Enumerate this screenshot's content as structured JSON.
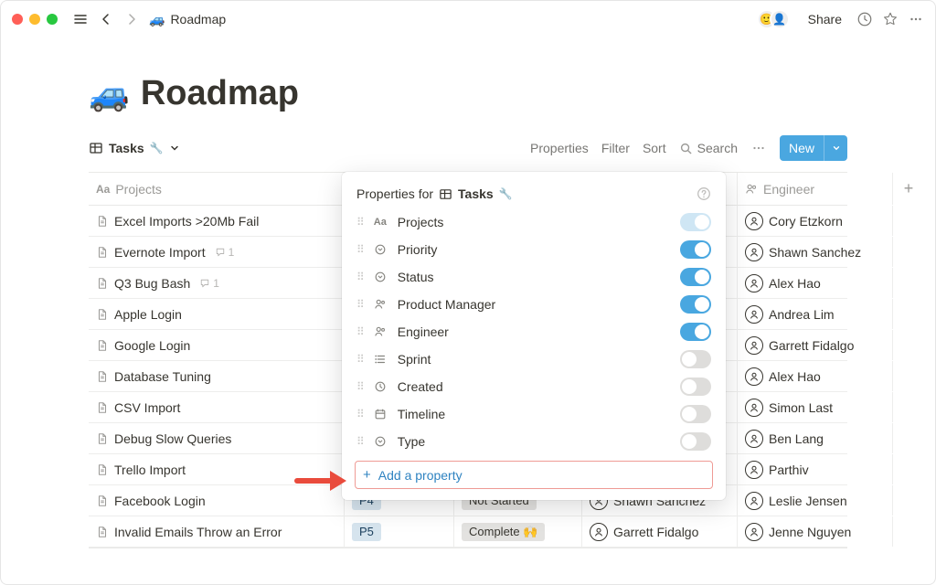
{
  "breadcrumb": {
    "emoji": "🚙",
    "title": "Roadmap"
  },
  "header": {
    "share": "Share"
  },
  "page": {
    "emoji": "🚙",
    "title": "Roadmap"
  },
  "view": {
    "tab_label": "Tasks",
    "tab_suffix": "🔧",
    "properties": "Properties",
    "filter": "Filter",
    "sort": "Sort",
    "search": "Search",
    "new": "New"
  },
  "columns": {
    "projects": "Projects",
    "priority": "",
    "status": "",
    "pm": "",
    "engineer": "Engineer",
    "add": "+"
  },
  "rows": [
    {
      "title": "Excel Imports >20Mb Fail",
      "comments": null,
      "priority": "",
      "status": "",
      "pm": "",
      "engineer": "Cory Etzkorn"
    },
    {
      "title": "Evernote Import",
      "comments": "1",
      "priority": "",
      "status": "",
      "pm": "",
      "engineer": "Shawn Sanchez"
    },
    {
      "title": "Q3 Bug Bash",
      "comments": "1",
      "priority": "",
      "status": "",
      "pm": "",
      "engineer": "Alex Hao"
    },
    {
      "title": "Apple Login",
      "comments": null,
      "priority": "",
      "status": "",
      "pm": "",
      "engineer": "Andrea Lim"
    },
    {
      "title": "Google Login",
      "comments": null,
      "priority": "",
      "status": "",
      "pm": "",
      "engineer": "Garrett Fidalgo"
    },
    {
      "title": "Database Tuning",
      "comments": null,
      "priority": "",
      "status": "",
      "pm": "",
      "engineer": "Alex Hao"
    },
    {
      "title": "CSV Import",
      "comments": null,
      "priority": "",
      "status": "",
      "pm": "",
      "engineer": "Simon Last"
    },
    {
      "title": "Debug Slow Queries",
      "comments": null,
      "priority": "",
      "status": "",
      "pm": "",
      "engineer": "Ben Lang"
    },
    {
      "title": "Trello Import",
      "comments": null,
      "priority": "",
      "status": "",
      "pm": "",
      "engineer": "Parthiv"
    },
    {
      "title": "Facebook Login",
      "comments": null,
      "priority": "P4",
      "status": "Not Started",
      "pm": "Shawn Sanchez",
      "engineer": "Leslie Jensen"
    },
    {
      "title": "Invalid Emails Throw an Error",
      "comments": null,
      "priority": "P5",
      "status": "Complete 🙌",
      "pm": "Garrett Fidalgo",
      "engineer": "Jenne Nguyen"
    }
  ],
  "popover": {
    "prefix": "Properties for",
    "view_label": "Tasks",
    "view_suffix": "🔧",
    "items": [
      {
        "icon": "text",
        "label": "Projects",
        "on": true,
        "half": true
      },
      {
        "icon": "select",
        "label": "Priority",
        "on": true
      },
      {
        "icon": "select",
        "label": "Status",
        "on": true
      },
      {
        "icon": "person",
        "label": "Product Manager",
        "on": true
      },
      {
        "icon": "person",
        "label": "Engineer",
        "on": true
      },
      {
        "icon": "list",
        "label": "Sprint",
        "on": false
      },
      {
        "icon": "clock",
        "label": "Created",
        "on": false
      },
      {
        "icon": "calendar",
        "label": "Timeline",
        "on": false
      },
      {
        "icon": "select",
        "label": "Type",
        "on": false
      }
    ],
    "add": "Add a property"
  }
}
